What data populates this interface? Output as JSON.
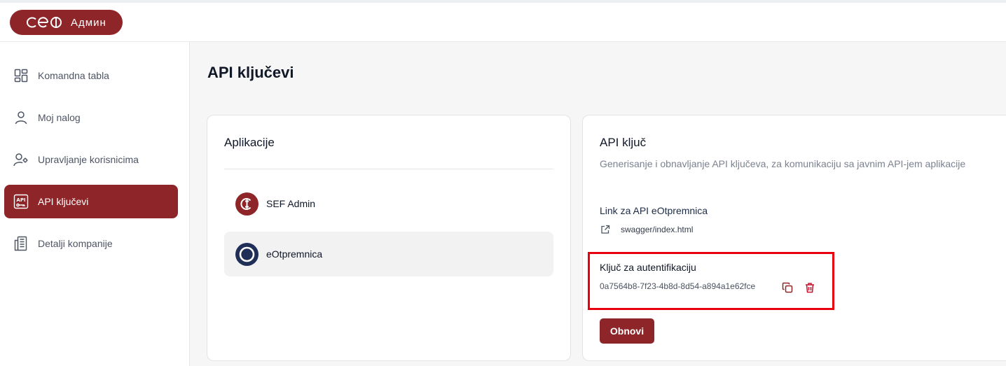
{
  "header": {
    "brand_logo": "cef",
    "brand_text": "Админ"
  },
  "sidebar": {
    "items": [
      {
        "label": "Komandna tabla",
        "icon": "dashboard-icon",
        "active": false
      },
      {
        "label": "Moj nalog",
        "icon": "user-icon",
        "active": false
      },
      {
        "label": "Upravljanje korisnicima",
        "icon": "user-settings-icon",
        "active": false
      },
      {
        "label": "API ključevi",
        "icon": "api-key-icon",
        "active": true
      },
      {
        "label": "Detalji kompanije",
        "icon": "building-icon",
        "active": false
      }
    ]
  },
  "main": {
    "title": "API ključevi",
    "apps_card": {
      "title": "Aplikacije",
      "apps": [
        {
          "name": "SEF Admin",
          "icon": "sef-icon",
          "selected": false,
          "color": "#8e2529"
        },
        {
          "name": "eOtpremnica",
          "icon": "eotpremnica-icon",
          "selected": true,
          "color": "#1f2f57"
        }
      ]
    },
    "key_card": {
      "title": "API ključ",
      "subtitle": "Generisanje i obnavljanje API ključeva, za komunikaciju sa javnim API-jem aplikacije",
      "link_label": "Link za API eOtpremnica",
      "link_text": "swagger/index.html",
      "auth_label": "Ključ za autentifikaciju",
      "auth_value": "0a7564b8-7f23-4b8d-8d54-a894a1e62fce",
      "renew_label": "Obnovi"
    }
  },
  "colors": {
    "accent": "#8e2529",
    "highlight": "#e8000e",
    "selected_bg": "#f2f2f3"
  }
}
